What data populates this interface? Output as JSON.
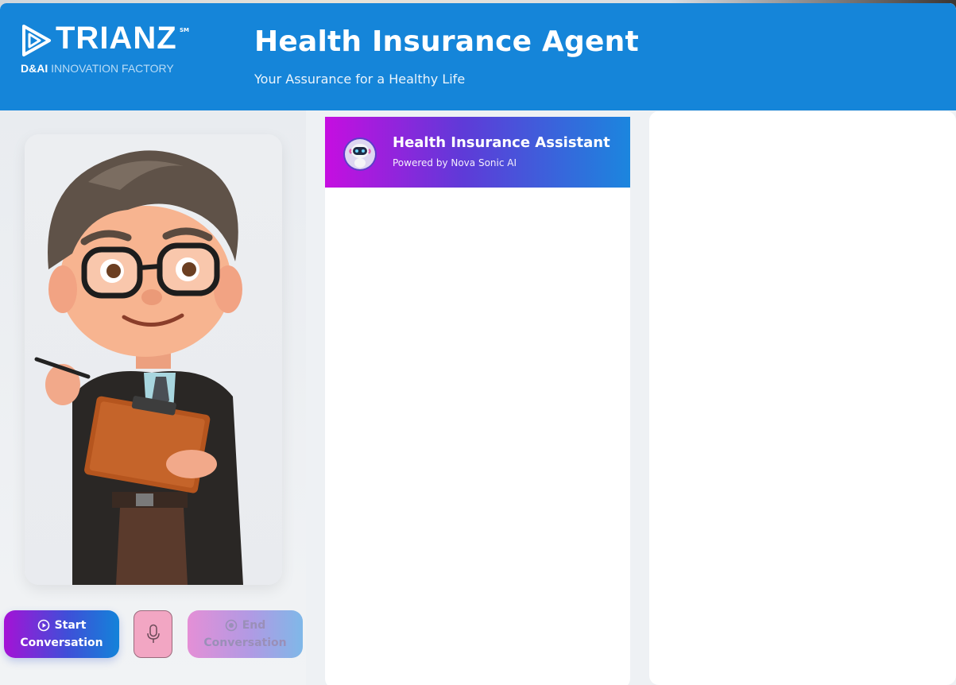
{
  "header": {
    "logo_word": "TRIANZ",
    "logo_sm": "SM",
    "logo_sub_bold": "D&AI",
    "logo_sub_light": "INNOVATION FACTORY",
    "title": "Health Insurance Agent",
    "subtitle": "Your Assurance for a Healthy Life",
    "background_color": "#1585d9"
  },
  "avatar": {
    "description_icon": "agent-avatar-illustration"
  },
  "controls": {
    "start_line1": "Start",
    "start_line2": "Conversation",
    "start_icon": "play-circle-icon",
    "mic_icon": "microphone-icon",
    "end_line1": "End",
    "end_line2": "Conversation",
    "end_icon": "stop-circle-icon"
  },
  "chat": {
    "title": "Health Insurance Assistant",
    "subtitle": "Powered by Nova Sonic AI",
    "icon": "robot-icon",
    "messages": []
  },
  "colors": {
    "accent_purple": "#c60ee0",
    "accent_blue": "#1b86de"
  }
}
